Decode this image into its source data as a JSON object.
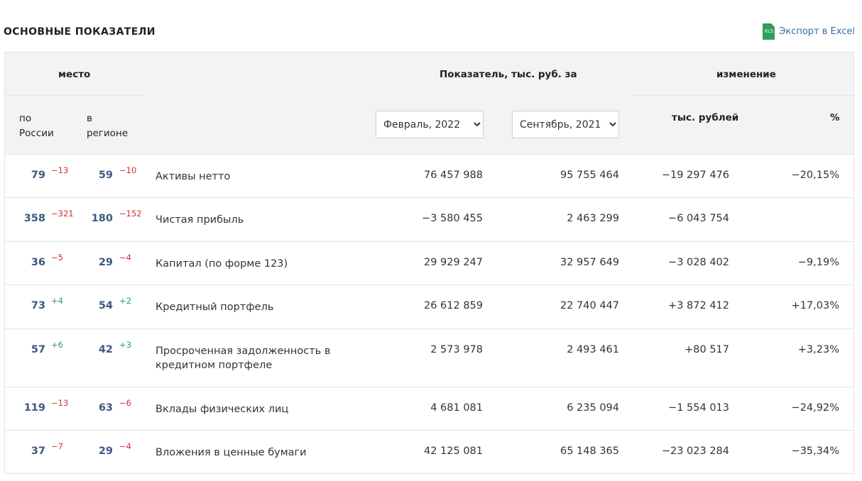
{
  "header": {
    "title": "ОСНОВНЫЕ ПОКАЗАТЕЛИ",
    "export_label": "Экспорт в Excel",
    "xls_icon_text": "XLS"
  },
  "table": {
    "col_place": "место",
    "col_place_russia": "по\nРоссии",
    "col_place_region": "в\nрегионе",
    "col_indicator": "Показатель, тыс. руб. за",
    "col_change": "изменение",
    "col_change_abs": "тыс. рублей",
    "col_change_pct": "%",
    "period1": "Февраль, 2022",
    "period2": "Сентябрь, 2021",
    "rows": [
      {
        "rank_ru": "79",
        "d_ru": "−13",
        "rank_reg": "59",
        "d_reg": "−10",
        "name": "Активы нетто",
        "v1": "76 457 988",
        "v2": "95 755 464",
        "chg": "−19 297 476",
        "pct": "−20,15%"
      },
      {
        "rank_ru": "358",
        "d_ru": "−321",
        "rank_reg": "180",
        "d_reg": "−152",
        "name": "Чистая прибыль",
        "v1": "−3 580 455",
        "v2": "2 463 299",
        "chg": "−6 043 754",
        "pct": ""
      },
      {
        "rank_ru": "36",
        "d_ru": "−5",
        "rank_reg": "29",
        "d_reg": "−4",
        "name": "Капитал (по форме 123)",
        "v1": "29 929 247",
        "v2": "32 957 649",
        "chg": "−3 028 402",
        "pct": "−9,19%"
      },
      {
        "rank_ru": "73",
        "d_ru": "+4",
        "rank_reg": "54",
        "d_reg": "+2",
        "name": "Кредитный портфель",
        "v1": "26 612 859",
        "v2": "22 740 447",
        "chg": "+3 872 412",
        "pct": "+17,03%"
      },
      {
        "rank_ru": "57",
        "d_ru": "+6",
        "rank_reg": "42",
        "d_reg": "+3",
        "name": "Просроченная задолженность в кредитном портфеле",
        "v1": "2 573 978",
        "v2": "2 493 461",
        "chg": "+80 517",
        "pct": "+3,23%"
      },
      {
        "rank_ru": "119",
        "d_ru": "−13",
        "rank_reg": "63",
        "d_reg": "−6",
        "name": "Вклады физических лиц",
        "v1": "4 681 081",
        "v2": "6 235 094",
        "chg": "−1 554 013",
        "pct": "−24,92%"
      },
      {
        "rank_ru": "37",
        "d_ru": "−7",
        "rank_reg": "29",
        "d_reg": "−4",
        "name": "Вложения в ценные бумаги",
        "v1": "42 125 081",
        "v2": "65 148 365",
        "chg": "−23 023 284",
        "pct": "−35,34%"
      }
    ]
  }
}
